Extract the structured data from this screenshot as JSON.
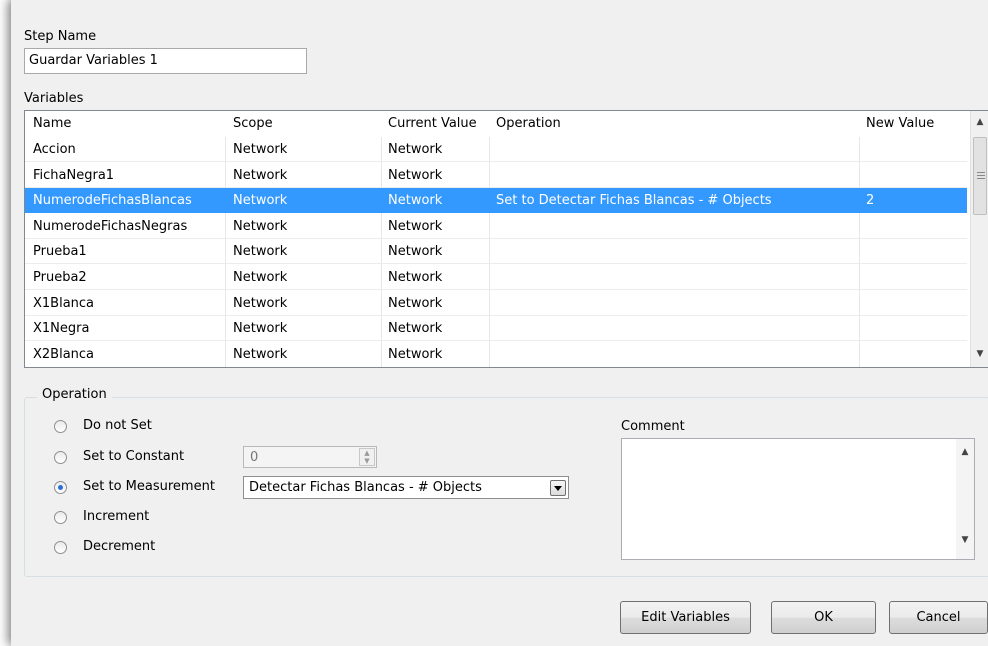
{
  "step_name": {
    "label": "Step Name",
    "value": "Guardar Variables 1"
  },
  "variables": {
    "label": "Variables",
    "columns": [
      "Name",
      "Scope",
      "Current Value",
      "Operation",
      "New Value"
    ],
    "rows": [
      {
        "name": "Accion",
        "scope": "Network",
        "current": "Network",
        "operation": "",
        "new_value": ""
      },
      {
        "name": "FichaNegra1",
        "scope": "Network",
        "current": "Network",
        "operation": "",
        "new_value": ""
      },
      {
        "name": "NumerodeFichasBlancas",
        "scope": "Network",
        "current": "Network",
        "operation": "Set to Detectar Fichas Blancas - # Objects",
        "new_value": "2"
      },
      {
        "name": "NumerodeFichasNegras",
        "scope": "Network",
        "current": "Network",
        "operation": "",
        "new_value": ""
      },
      {
        "name": "Prueba1",
        "scope": "Network",
        "current": "Network",
        "operation": "",
        "new_value": ""
      },
      {
        "name": "Prueba2",
        "scope": "Network",
        "current": "Network",
        "operation": "",
        "new_value": ""
      },
      {
        "name": "X1Blanca",
        "scope": "Network",
        "current": "Network",
        "operation": "",
        "new_value": ""
      },
      {
        "name": "X1Negra",
        "scope": "Network",
        "current": "Network",
        "operation": "",
        "new_value": ""
      },
      {
        "name": "X2Blanca",
        "scope": "Network",
        "current": "Network",
        "operation": "",
        "new_value": ""
      }
    ],
    "selected_row": 2
  },
  "operation": {
    "title": "Operation",
    "options": [
      "Do not Set",
      "Set to Constant",
      "Set to Measurement",
      "Increment",
      "Decrement"
    ],
    "selected": "Set to Measurement",
    "constant_value": "0",
    "measurement_value": "Detectar Fichas Blancas - # Objects"
  },
  "comment": {
    "label": "Comment",
    "value": ""
  },
  "buttons": {
    "edit_variables": "Edit Variables",
    "ok": "OK",
    "cancel": "Cancel"
  },
  "colors": {
    "selection": "#3399ff",
    "panel": "#f0f0f0"
  }
}
